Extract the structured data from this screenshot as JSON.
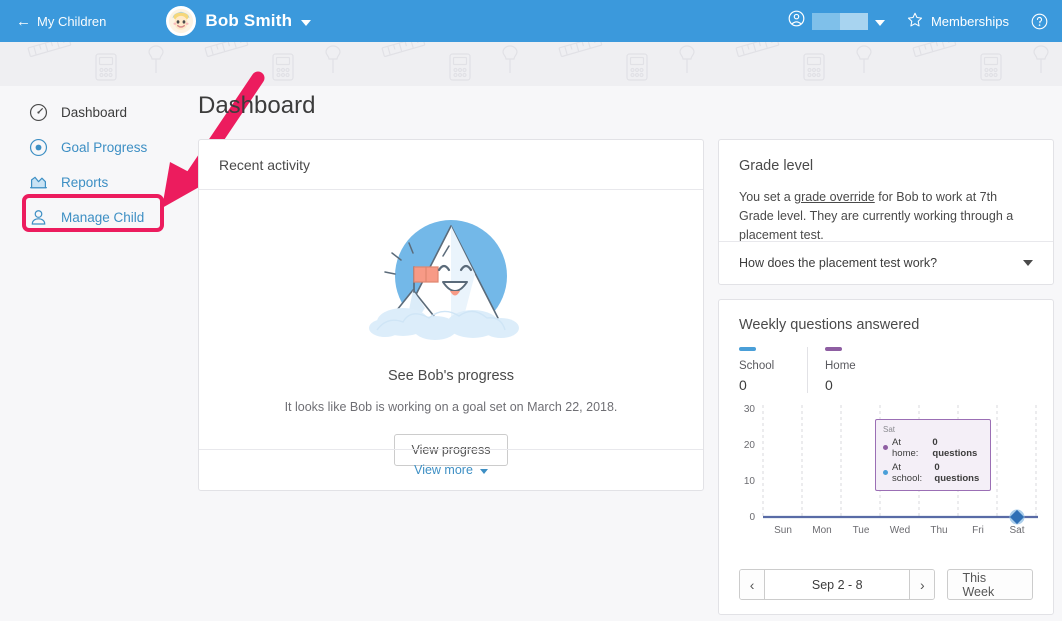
{
  "header": {
    "back_label": "My Children",
    "back_icon": "arrow-left-icon",
    "child_name": "Bob Smith",
    "avatar_icon": "child-avatar",
    "account_icon": "account-circle-icon",
    "account_name_redacted": "",
    "memberships_label": "Memberships",
    "memberships_icon": "star-icon",
    "help_icon": "help-circle-icon",
    "bg_color": "#3b99dc"
  },
  "sidebar": {
    "items": [
      {
        "label": "Dashboard",
        "icon": "speedometer-icon",
        "active": true
      },
      {
        "label": "Goal Progress",
        "icon": "target-icon",
        "active": false
      },
      {
        "label": "Reports",
        "icon": "chart-area-icon",
        "active": false
      },
      {
        "label": "Manage Child",
        "icon": "person-icon",
        "active": false
      }
    ]
  },
  "annotation": {
    "highlight_target": "Manage Child",
    "color": "#ec1c5e",
    "arrow_icon": "pointer-arrow"
  },
  "main": {
    "page_title": "Dashboard"
  },
  "recent_activity": {
    "header": "Recent activity",
    "illustration": "mountain-with-flag-illustration",
    "title": "See Bob's progress",
    "subtitle": "It looks like Bob is working on a goal set on March 22, 2018.",
    "button_label": "View progress",
    "footer_link": "View more",
    "footer_caret_icon": "chevron-down-icon"
  },
  "grade_level": {
    "title": "Grade level",
    "text_before_link": "You set a ",
    "link_text": "grade override",
    "text_after_link": " for Bob to work at 7th Grade level. They are currently working through a placement test.",
    "accordion_question": "How does the placement test work?",
    "accordion_icon": "chevron-down-icon"
  },
  "weekly": {
    "title": "Weekly questions answered",
    "legend": [
      {
        "name": "School",
        "value": "0",
        "color": "#4a9fd8"
      },
      {
        "name": "Home",
        "value": "0",
        "color": "#8e5ea2"
      }
    ],
    "prev_label": "‹",
    "next_label": "›",
    "range_label": "Sep 2 - 8",
    "this_week_label": "This Week",
    "tooltip": {
      "day": "Sat",
      "rows": [
        {
          "label": "At home:",
          "value": "0 questions",
          "color": "#8e5ea2"
        },
        {
          "label": "At school:",
          "value": "0 questions",
          "color": "#4a9fd8"
        }
      ]
    }
  },
  "chart_data": {
    "type": "line",
    "title": "Weekly questions answered",
    "xlabel": "",
    "ylabel": "",
    "categories": [
      "Sun",
      "Mon",
      "Tue",
      "Wed",
      "Thu",
      "Fri",
      "Sat"
    ],
    "yticks": [
      0,
      10,
      20,
      30
    ],
    "ylim": [
      0,
      30
    ],
    "grid": true,
    "legend_position": "top-left",
    "highlighted_point": "Sat",
    "series": [
      {
        "name": "School",
        "values": [
          0,
          0,
          0,
          0,
          0,
          0,
          0
        ],
        "color": "#4a9fd8"
      },
      {
        "name": "Home",
        "values": [
          0,
          0,
          0,
          0,
          0,
          0,
          0
        ],
        "color": "#8e5ea2"
      }
    ]
  }
}
